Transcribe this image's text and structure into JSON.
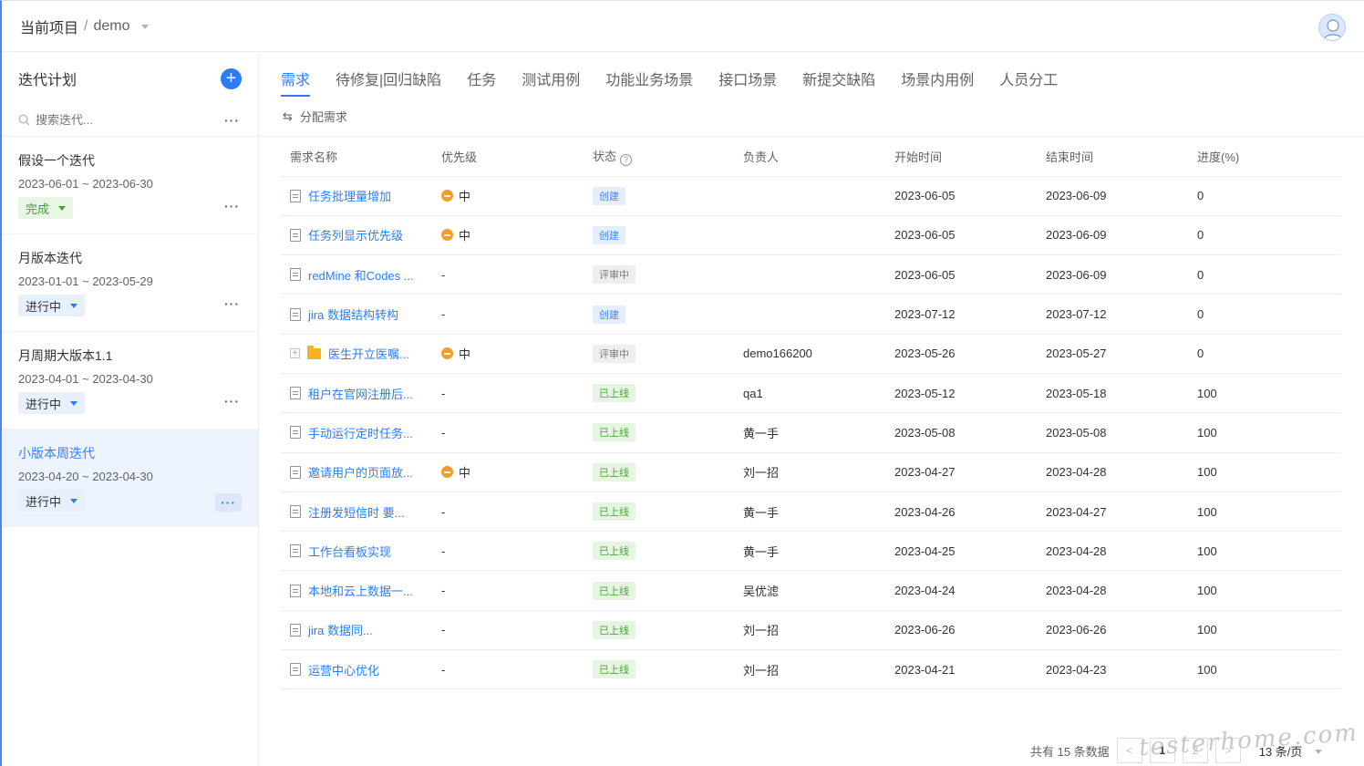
{
  "header": {
    "breadcrumb_root": "当前项目",
    "separator": "/",
    "project": "demo"
  },
  "sidebar": {
    "title": "迭代计划",
    "add_label": "+",
    "search_placeholder": "搜索迭代...",
    "more_label": "···",
    "iterations": [
      {
        "name": "假设一个迭代",
        "date": "2023-06-01 ~ 2023-06-30",
        "status": "完成"
      },
      {
        "name": "月版本迭代",
        "date": "2023-01-01 ~ 2023-05-29",
        "status": "进行中"
      },
      {
        "name": "月周期大版本1.1",
        "date": "2023-04-01 ~ 2023-04-30",
        "status": "进行中"
      },
      {
        "name": "小版本周迭代",
        "date": "2023-04-20 ~ 2023-04-30",
        "status": "进行中"
      }
    ]
  },
  "tabs": [
    "需求",
    "待修复|回归缺陷",
    "任务",
    "测试用例",
    "功能业务场景",
    "接口场景",
    "新提交缺陷",
    "场景内用例",
    "人员分工"
  ],
  "toolbar": {
    "assign_label": "分配需求",
    "assign_icon": "⇆"
  },
  "table": {
    "headers": [
      "需求名称",
      "优先级",
      "状态",
      "负责人",
      "开始时间",
      "结束时间",
      "进度(%)"
    ],
    "rows": [
      {
        "name": "任务批理量增加",
        "priority": "中",
        "status": "创建",
        "owner": "",
        "start": "2023-06-05",
        "end": "2023-06-09",
        "progress": "0"
      },
      {
        "name": "任务列显示优先级",
        "priority": "中",
        "status": "创建",
        "owner": "",
        "start": "2023-06-05",
        "end": "2023-06-09",
        "progress": "0"
      },
      {
        "name": "redMine 和Codes ...",
        "priority": "-",
        "status": "评审中",
        "owner": "",
        "start": "2023-06-05",
        "end": "2023-06-09",
        "progress": "0"
      },
      {
        "name": "jira 数据结构转构",
        "priority": "-",
        "status": "创建",
        "owner": "",
        "start": "2023-07-12",
        "end": "2023-07-12",
        "progress": "0"
      },
      {
        "name": "医生开立医嘱...",
        "priority": "中",
        "status": "评审中",
        "owner": "demo166200",
        "start": "2023-05-26",
        "end": "2023-05-27",
        "progress": "0"
      },
      {
        "name": "租户在官网注册后...",
        "priority": "-",
        "status": "已上线",
        "owner": "qa1",
        "start": "2023-05-12",
        "end": "2023-05-18",
        "progress": "100"
      },
      {
        "name": "手动运行定时任务...",
        "priority": "-",
        "status": "已上线",
        "owner": "黄一手",
        "start": "2023-05-08",
        "end": "2023-05-08",
        "progress": "100"
      },
      {
        "name": "邀请用户的页面放...",
        "priority": "中",
        "status": "已上线",
        "owner": "刘一招",
        "start": "2023-04-27",
        "end": "2023-04-28",
        "progress": "100"
      },
      {
        "name": "注册发短信时 要...",
        "priority": "-",
        "status": "已上线",
        "owner": "黄一手",
        "start": "2023-04-26",
        "end": "2023-04-27",
        "progress": "100"
      },
      {
        "name": "工作台看板实现",
        "priority": "-",
        "status": "已上线",
        "owner": "黄一手",
        "start": "2023-04-25",
        "end": "2023-04-28",
        "progress": "100"
      },
      {
        "name": "本地和云上数据一...",
        "priority": "-",
        "status": "已上线",
        "owner": "吴优滤",
        "start": "2023-04-24",
        "end": "2023-04-28",
        "progress": "100"
      },
      {
        "name": "jira 数据同...",
        "priority": "-",
        "status": "已上线",
        "owner": "刘一招",
        "start": "2023-06-26",
        "end": "2023-06-26",
        "progress": "100"
      },
      {
        "name": "运营中心优化",
        "priority": "-",
        "status": "已上线",
        "owner": "刘一招",
        "start": "2023-04-21",
        "end": "2023-04-23",
        "progress": "100"
      }
    ]
  },
  "pager": {
    "total_text": "共有 15 条数据",
    "prev": "<",
    "pages": [
      "1",
      "2"
    ],
    "next": ">",
    "page_size": "13 条/页"
  },
  "watermark": "testerhome.com",
  "colors": {
    "accent": "#2d7cf6",
    "priority_mid": "#f39c2e",
    "online": "#4fa33c"
  }
}
